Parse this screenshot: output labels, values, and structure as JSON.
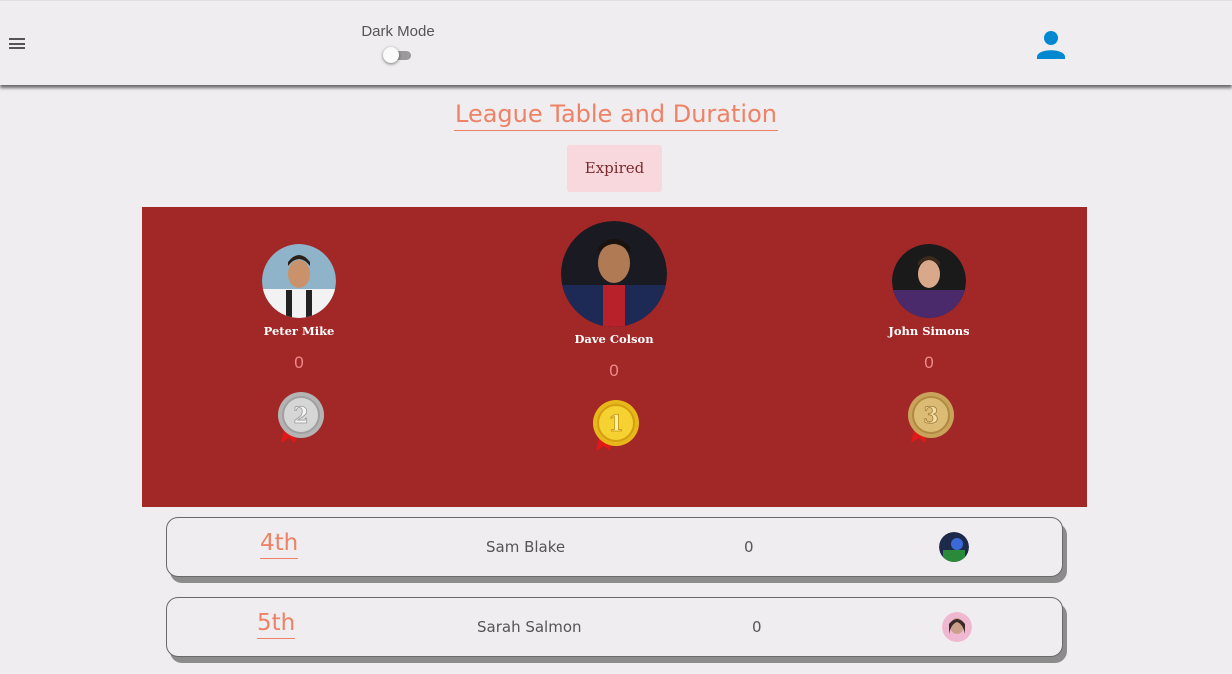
{
  "header": {
    "dark_mode_label": "Dark Mode",
    "menu_icon": "menu-icon",
    "user_icon": "account-icon",
    "accent_color": "#0288d1"
  },
  "page": {
    "title": "League Table and Duration",
    "status": "Expired"
  },
  "podium": [
    {
      "rank": 2,
      "name": "Peter Mike",
      "score": "0",
      "medal": "silver-medal-icon"
    },
    {
      "rank": 1,
      "name": "Dave Colson",
      "score": "0",
      "medal": "gold-medal-icon"
    },
    {
      "rank": 3,
      "name": "John Simons",
      "score": "0",
      "medal": "bronze-medal-icon"
    }
  ],
  "rankings": [
    {
      "position": "4th",
      "name": "Sam Blake",
      "score": "0"
    },
    {
      "position": "5th",
      "name": "Sarah Salmon",
      "score": "0"
    }
  ],
  "colors": {
    "podium_bg": "#a22828",
    "accent": "#ee8266",
    "badge_bg": "#f8d8dc"
  }
}
